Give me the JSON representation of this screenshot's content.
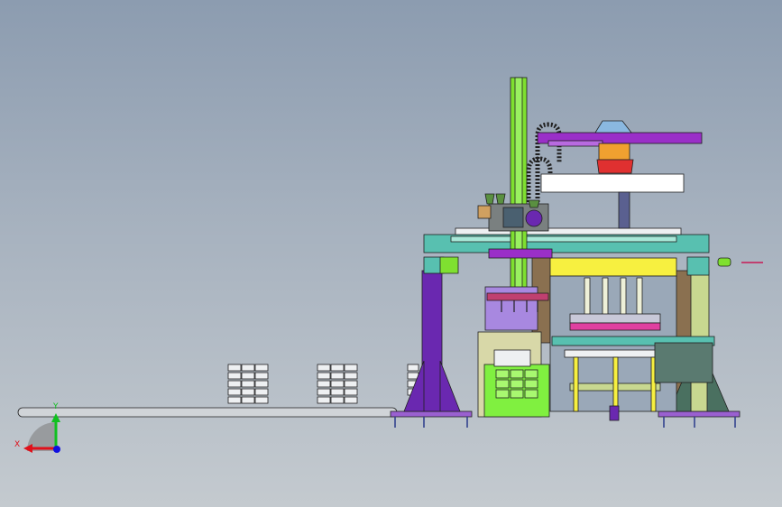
{
  "viewport": {
    "background_top": "#8c9cb0",
    "background_bottom": "#c4cacf"
  },
  "triad": {
    "x_label": "X",
    "y_label": "Y",
    "x_color": "#e0101a",
    "y_color": "#10c020",
    "z_color": "#1010e0"
  },
  "model": {
    "colors": {
      "column_green": "#7fe030",
      "beam_purple": "#9a2fc8",
      "head_orange": "#f0a030",
      "head_red": "#e03030",
      "frame_teal": "#58c0b0",
      "leg_purple": "#6a28b0",
      "yellow": "#f7f040",
      "box_lavender": "#a888e0",
      "bin_green": "#80f040",
      "leg_brown": "#8a7050",
      "leg_olive": "#c8d890",
      "base_olive": "#4a7060",
      "outline": "#202020"
    },
    "icons": [
      "view-triad-icon"
    ]
  }
}
